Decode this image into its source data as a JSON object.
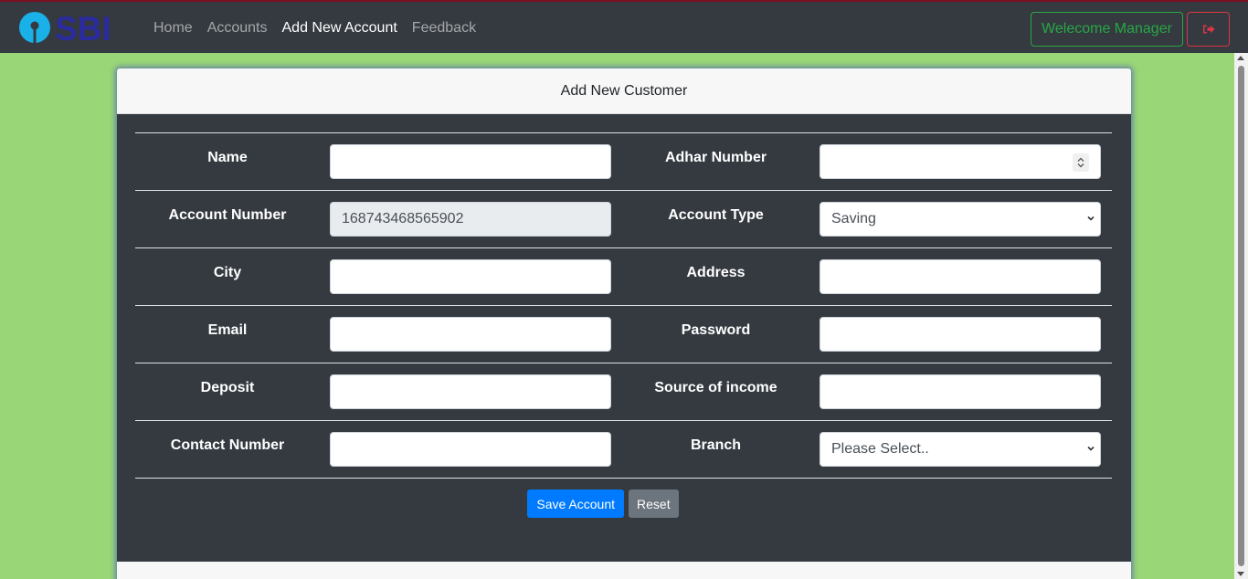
{
  "navbar": {
    "brand": "SBI",
    "links": [
      {
        "label": "Home",
        "active": false
      },
      {
        "label": "Accounts",
        "active": false
      },
      {
        "label": "Add New Account",
        "active": true
      },
      {
        "label": "Feedback",
        "active": false
      }
    ],
    "welcome_label": "Welecome Manager",
    "logout_icon": "sign-out-icon"
  },
  "card": {
    "title": "Add New Customer"
  },
  "form": {
    "name": {
      "label": "Name",
      "value": ""
    },
    "adhar": {
      "label": "Adhar Number",
      "value": ""
    },
    "account_number": {
      "label": "Account Number",
      "value": "168743468565902"
    },
    "account_type": {
      "label": "Account Type",
      "value": "Saving"
    },
    "city": {
      "label": "City",
      "value": ""
    },
    "address": {
      "label": "Address",
      "value": ""
    },
    "email": {
      "label": "Email",
      "value": ""
    },
    "password": {
      "label": "Password",
      "value": ""
    },
    "deposit": {
      "label": "Deposit",
      "value": ""
    },
    "source_of_income": {
      "label": "Source of income",
      "value": ""
    },
    "contact_number": {
      "label": "Contact Number",
      "value": ""
    },
    "branch": {
      "label": "Branch",
      "value": "Please Select.."
    }
  },
  "buttons": {
    "save": "Save Account",
    "reset": "Reset"
  },
  "colors": {
    "page_bg": "#98d677",
    "navbar_bg": "#343a40",
    "primary": "#007bff",
    "success": "#28a745",
    "danger": "#dc3545",
    "brand_blue": "#2b2b9e",
    "brand_cyan": "#1ab0e8"
  }
}
